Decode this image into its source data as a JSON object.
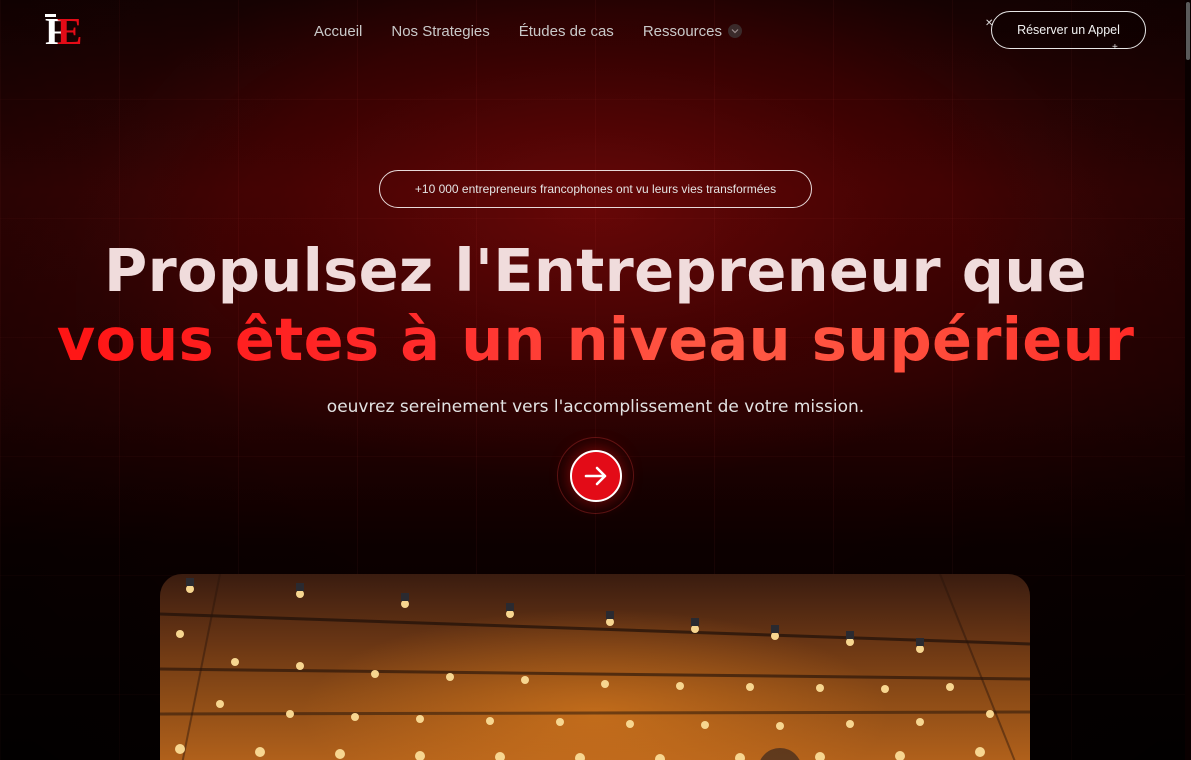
{
  "header": {
    "logo_text": "FE",
    "nav": [
      {
        "label": "Accueil"
      },
      {
        "label": "Nos Strategies"
      },
      {
        "label": "Études de cas"
      },
      {
        "label": "Ressources",
        "has_dropdown": true
      }
    ],
    "cta_label": "Réserver un Appel"
  },
  "hero": {
    "badge": "+10 000 entrepreneurs francophones ont vu leurs vies transformées",
    "headline_line1": "Propulsez l'Entrepreneur que",
    "headline_line2": "vous êtes à un niveau supérieur",
    "subline": "oeuvrez sereinement vers l'accomplissement de votre mission.",
    "arrow_icon": "arrow-right-icon"
  },
  "colors": {
    "accent": "#e30b17",
    "headline_gradient_start": "#ff1111",
    "headline_gradient_end": "#ff5a45",
    "background": "#2a0202"
  },
  "media": {
    "hero_image": "stage-with-spotlights-photo"
  }
}
